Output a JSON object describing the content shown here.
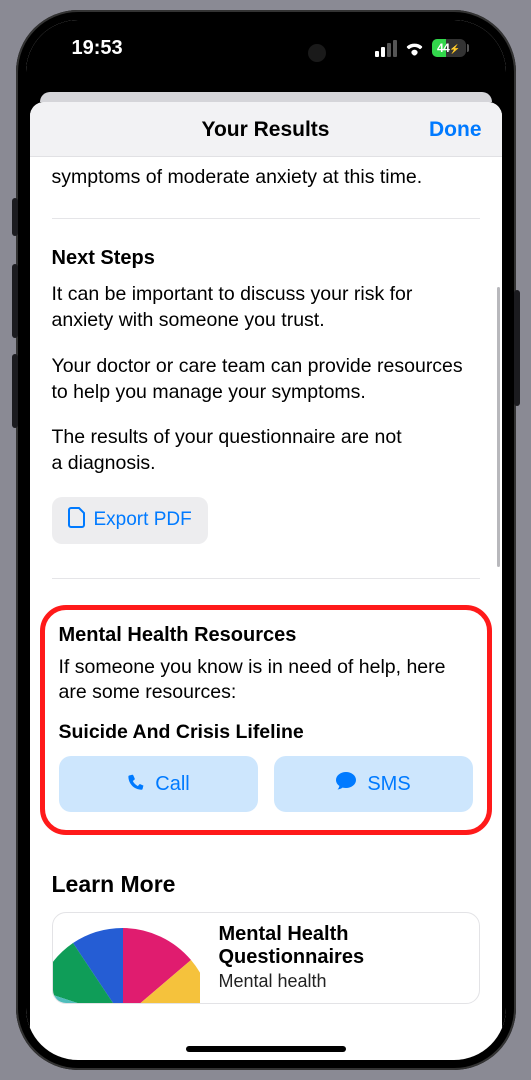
{
  "status": {
    "time": "19:53",
    "battery_percent": "44"
  },
  "header": {
    "title": "Your Results",
    "done": "Done"
  },
  "truncated_result": "symptoms of moderate anxiety at this time.",
  "next_steps": {
    "title": "Next Steps",
    "p1": "It can be important to discuss your risk for anxiety with someone you trust.",
    "p2": "Your doctor or care team can provide resources to help you manage your symptoms.",
    "p3": "The results of your questionnaire are not a diagnosis.",
    "export_label": "Export PDF"
  },
  "resources": {
    "title": "Mental Health Resources",
    "intro": "If someone you know is in need of help, here are some resources:",
    "lifeline_title": "Suicide And Crisis Lifeline",
    "call_label": "Call",
    "sms_label": "SMS"
  },
  "learn_more": {
    "title": "Learn More",
    "card": {
      "title": "Mental Health Questionnaires",
      "subtitle": "Mental health"
    }
  }
}
